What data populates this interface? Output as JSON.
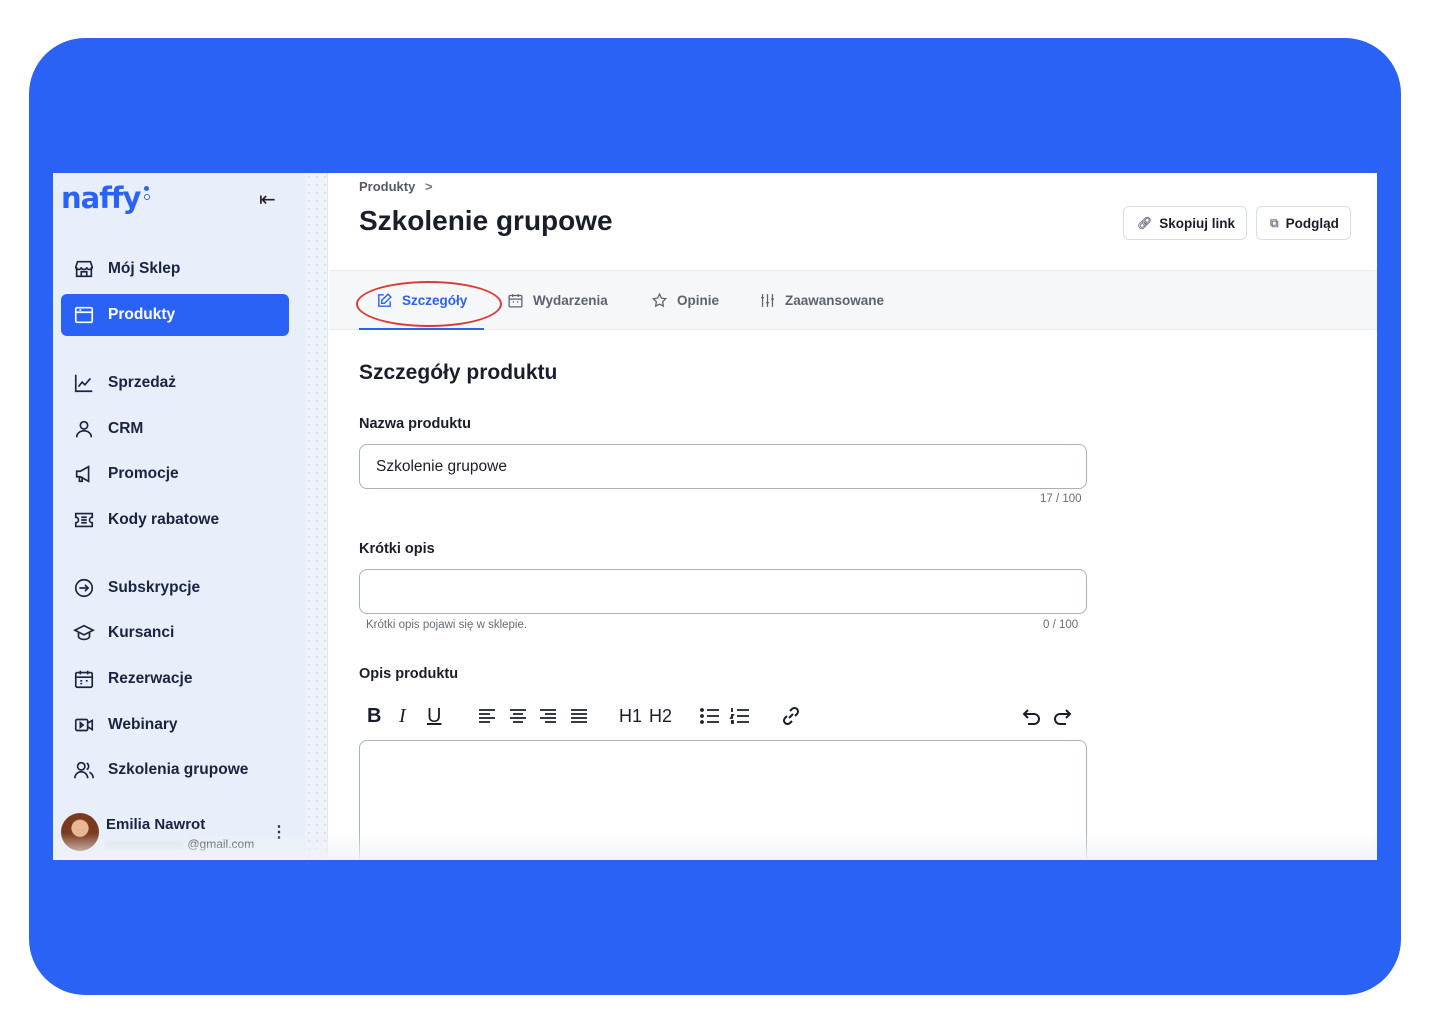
{
  "brand": {
    "name": "naffy",
    "dot_colors": [
      "#2a62f5",
      "#ffffff"
    ]
  },
  "sidebar": {
    "collapse_icon": "collapse-left-icon",
    "items": [
      {
        "label": "Mój Sklep",
        "icon": "store-icon"
      },
      {
        "label": "Produkty",
        "icon": "box-icon",
        "active": true
      },
      {
        "label": "Sprzedaż",
        "icon": "chart-line-icon"
      },
      {
        "label": "CRM",
        "icon": "user-icon"
      },
      {
        "label": "Promocje",
        "icon": "megaphone-icon"
      },
      {
        "label": "Kody rabatowe",
        "icon": "coupon-icon"
      },
      {
        "label": "Subskrypcje",
        "icon": "subscription-icon"
      },
      {
        "label": "Kursanci",
        "icon": "graduation-cap-icon"
      },
      {
        "label": "Rezerwacje",
        "icon": "calendar-icon"
      },
      {
        "label": "Webinary",
        "icon": "video-icon"
      },
      {
        "label": "Szkolenia grupowe",
        "icon": "users-icon"
      }
    ],
    "user": {
      "name": "Emilia Nawrot",
      "email_suffix": "@gmail.com"
    }
  },
  "header": {
    "breadcrumb": "Produkty",
    "breadcrumb_sep": ">",
    "title": "Szkolenie grupowe",
    "copy_link_label": "Skopiuj link",
    "preview_label": "Podgląd"
  },
  "tabs": [
    {
      "label": "Szczegóły",
      "icon": "edit-icon",
      "active": true
    },
    {
      "label": "Wydarzenia",
      "icon": "calendar-icon"
    },
    {
      "label": "Opinie",
      "icon": "star-icon"
    },
    {
      "label": "Zaawansowane",
      "icon": "sliders-icon"
    }
  ],
  "form": {
    "section_title": "Szczegóły produktu",
    "name_label": "Nazwa produktu",
    "name_value": "Szkolenie grupowe",
    "name_counter": "17 / 100",
    "short_label": "Krótki opis",
    "short_value": "",
    "short_hint": "Krótki opis pojawi się w sklepie.",
    "short_counter": "0 / 100",
    "desc_label": "Opis produktu",
    "toolbar": {
      "bold": "B",
      "italic": "I",
      "underline": "U",
      "h1": "H1",
      "h2": "H2"
    }
  },
  "colors": {
    "accent": "#2a62f5",
    "annotation_ring": "#d83b35"
  }
}
